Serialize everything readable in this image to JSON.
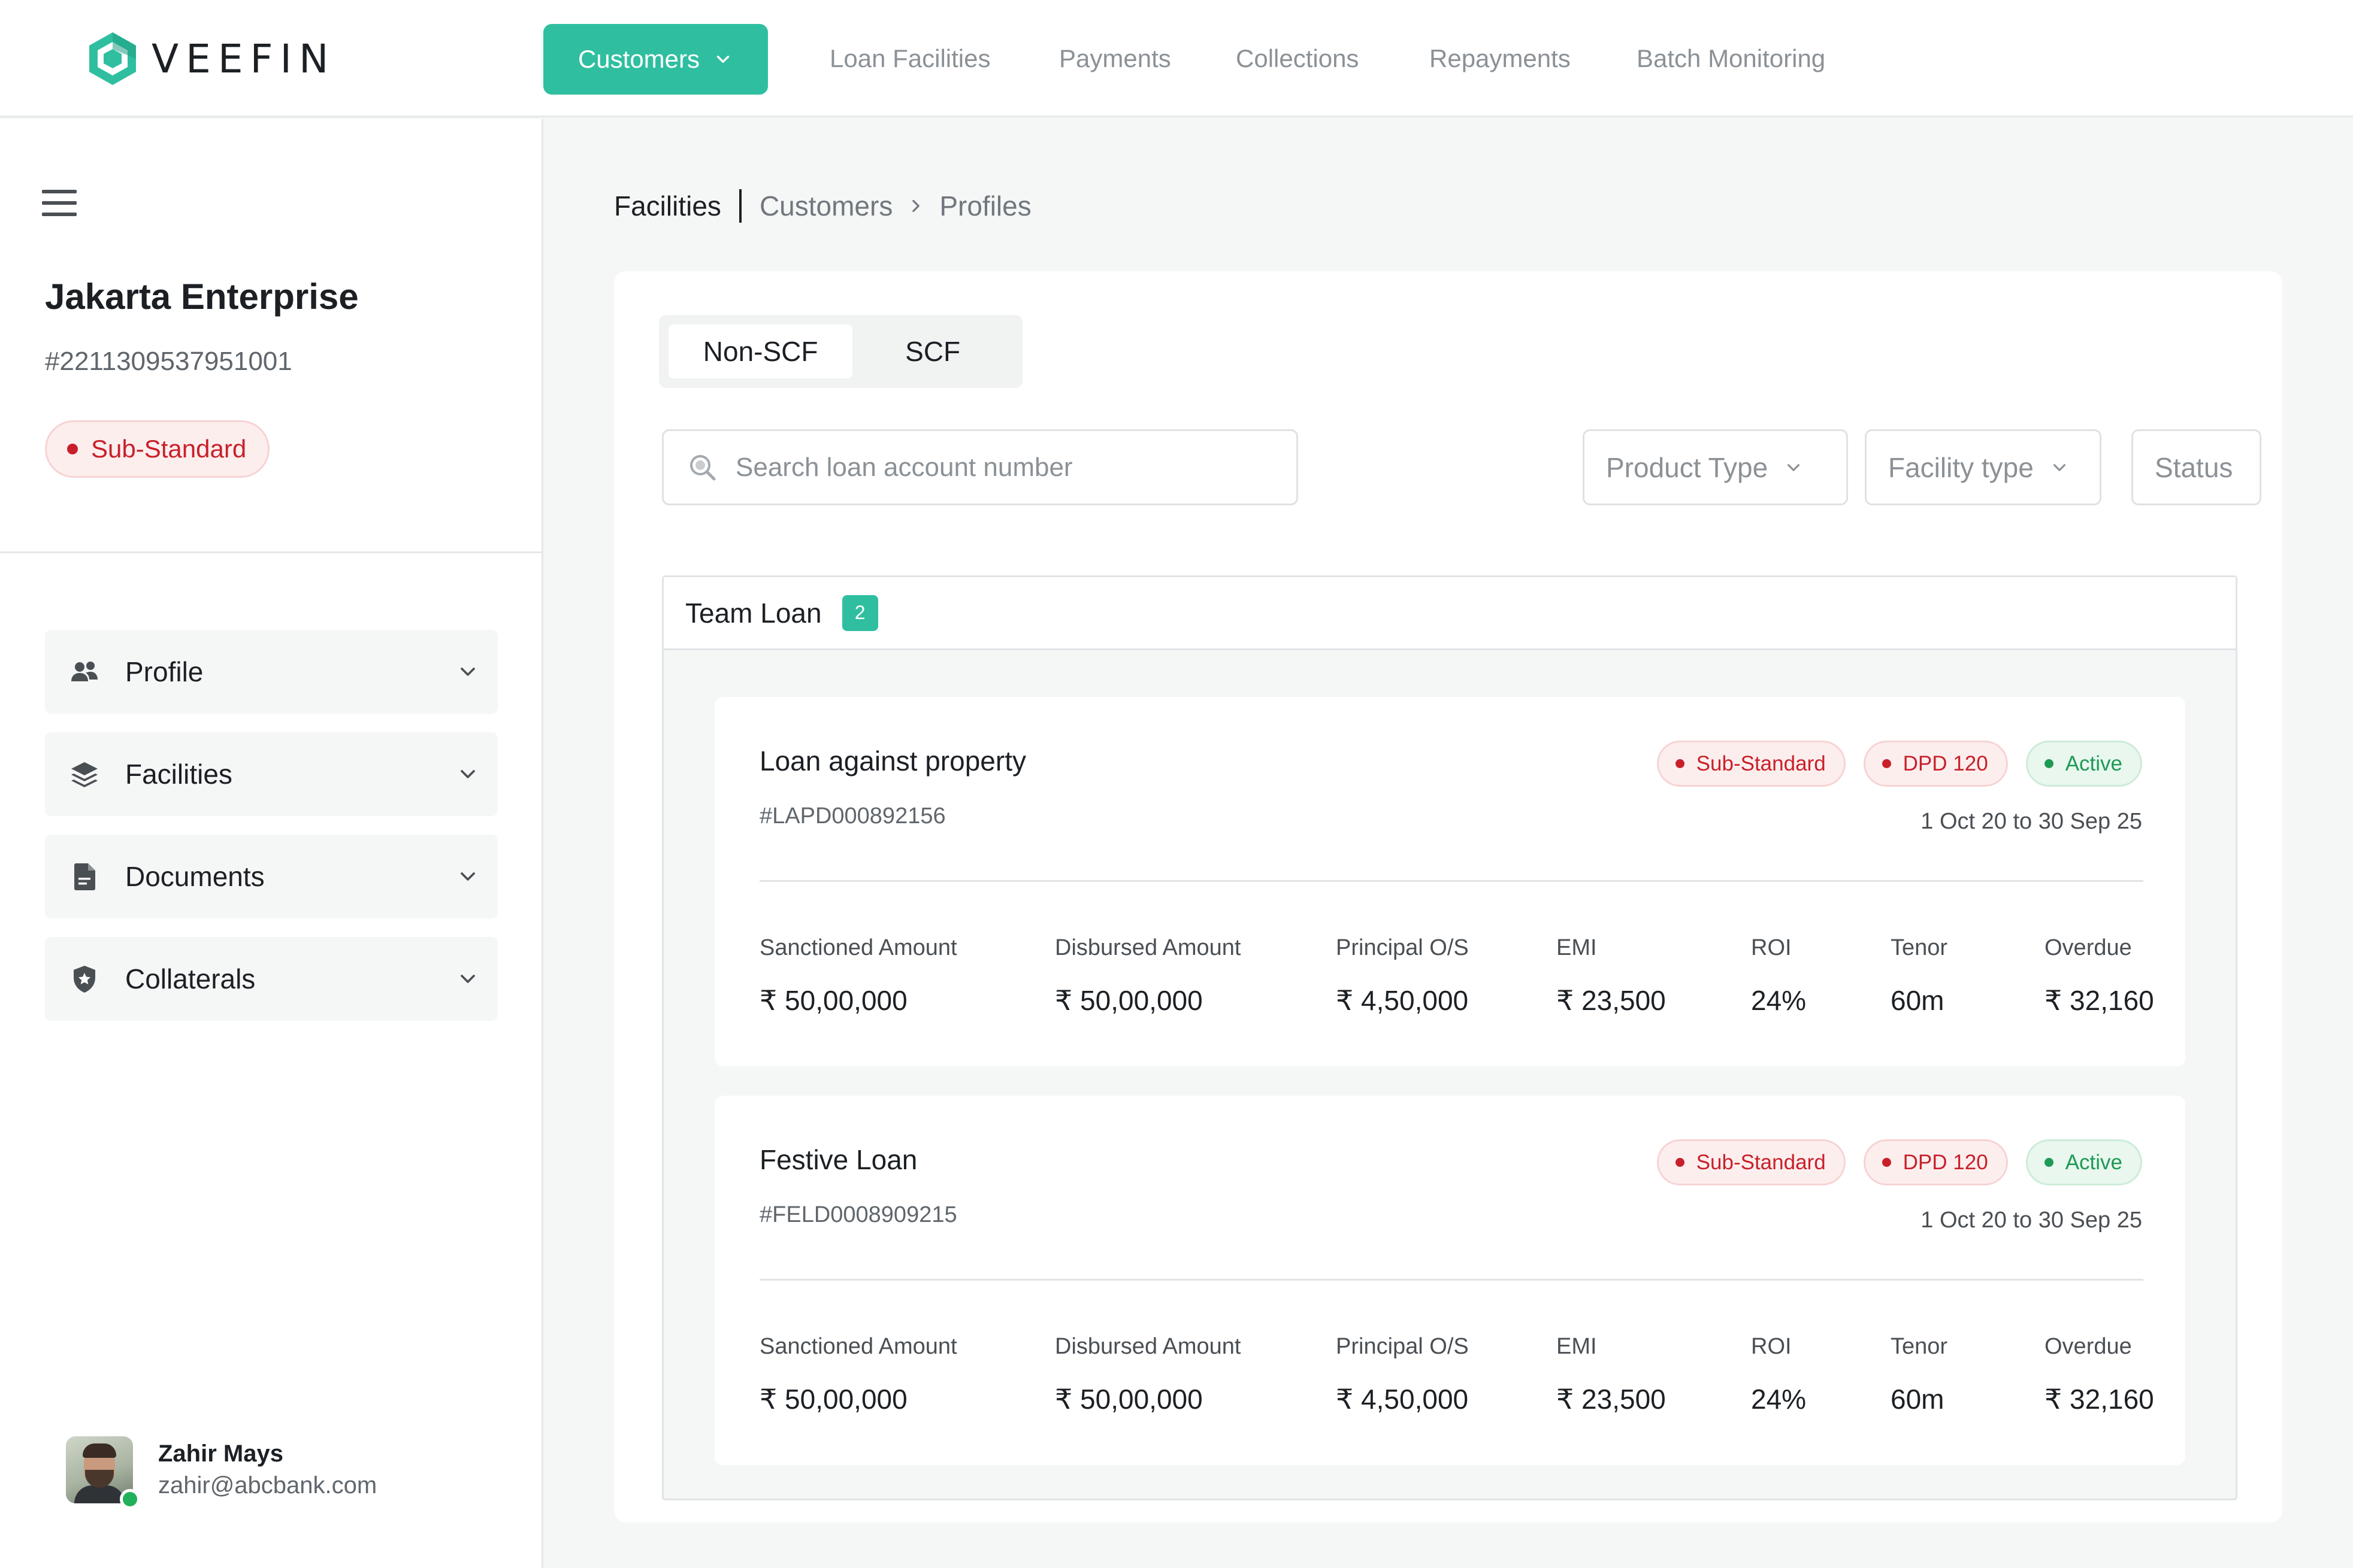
{
  "brand": {
    "name": "VEEFIN",
    "accent": "#2fbfa0"
  },
  "nav": {
    "active": "Customers",
    "links": [
      "Loan Facilities",
      "Payments",
      "Collections",
      "Repayments",
      "Batch Monitoring"
    ]
  },
  "sidebar": {
    "company_name": "Jakarta Enterprise",
    "company_id": "#2211309537951001",
    "status": "Sub-Standard",
    "items": [
      {
        "label": "Profile",
        "icon": "users-icon"
      },
      {
        "label": "Facilities",
        "icon": "layers-icon"
      },
      {
        "label": "Documents",
        "icon": "document-icon"
      },
      {
        "label": "Collaterals",
        "icon": "shield-star-icon"
      }
    ],
    "user": {
      "name": "Zahir Mays",
      "email": "zahir@abcbank.com"
    }
  },
  "breadcrumb": {
    "root": "Facilities",
    "level1": "Customers",
    "level2": "Profiles"
  },
  "tabs": {
    "active": "Non-SCF",
    "inactive": "SCF"
  },
  "search": {
    "placeholder": "Search loan account number",
    "value": ""
  },
  "filters": {
    "product_type": "Product Type",
    "facility_type": "Facility type",
    "status": "Status"
  },
  "group": {
    "title": "Team Loan",
    "count": "2"
  },
  "loans": [
    {
      "name": "Loan against property",
      "id": "#LAPD000892156",
      "chips": [
        "Sub-Standard",
        "DPD 120",
        "Active"
      ],
      "dates": "1 Oct 20 to 30 Sep 25",
      "metrics": [
        {
          "label": "Sanctioned Amount",
          "value": "₹ 50,00,000"
        },
        {
          "label": "Disbursed Amount",
          "value": "₹ 50,00,000"
        },
        {
          "label": "Principal O/S",
          "value": "₹ 4,50,000"
        },
        {
          "label": "EMI",
          "value": "₹ 23,500"
        },
        {
          "label": "ROI",
          "value": "24%"
        },
        {
          "label": "Tenor",
          "value": "60m"
        },
        {
          "label": "Overdue",
          "value": "₹ 32,160"
        }
      ]
    },
    {
      "name": "Festive Loan",
      "id": "#FELD0008909215",
      "chips": [
        "Sub-Standard",
        "DPD 120",
        "Active"
      ],
      "dates": "1 Oct 20 to 30 Sep 25",
      "metrics": [
        {
          "label": "Sanctioned Amount",
          "value": "₹ 50,00,000"
        },
        {
          "label": "Disbursed Amount",
          "value": "₹ 50,00,000"
        },
        {
          "label": "Principal O/S",
          "value": "₹ 4,50,000"
        },
        {
          "label": "EMI",
          "value": "₹ 23,500"
        },
        {
          "label": "ROI",
          "value": "24%"
        },
        {
          "label": "Tenor",
          "value": "60m"
        },
        {
          "label": "Overdue",
          "value": "₹ 32,160"
        }
      ]
    }
  ]
}
